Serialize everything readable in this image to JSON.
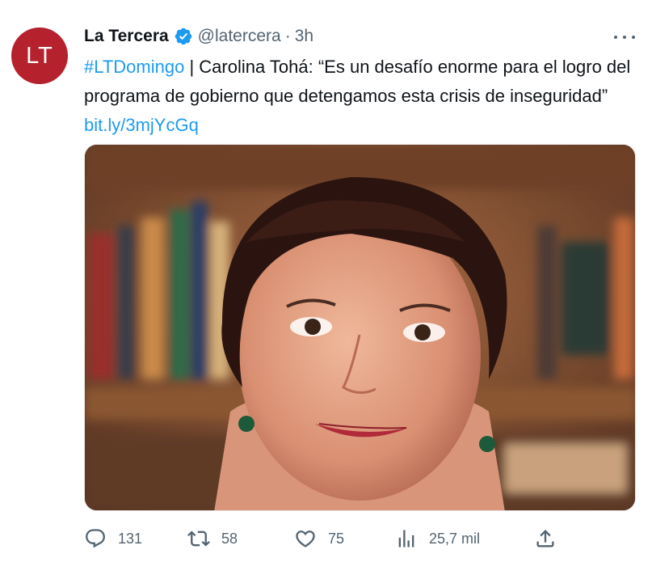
{
  "tweet": {
    "avatar_text": "LT",
    "author_name": "La Tercera",
    "handle": "@latercera",
    "separator": "·",
    "time": "3h",
    "hashtag": "#LTDomingo",
    "body": " | Carolina Tohá: “Es un desafío enorme para el logro del programa de gobierno que detengamos esta crisis de inseguridad” ",
    "link": "bit.ly/3mjYcGq"
  },
  "actions": {
    "replies": "131",
    "retweets": "58",
    "likes": "75",
    "views": "25,7 mil"
  },
  "colors": {
    "avatar_bg": "#b5212d",
    "link": "#1d9bf0",
    "verified": "#1d9bf0",
    "muted": "#536471"
  }
}
